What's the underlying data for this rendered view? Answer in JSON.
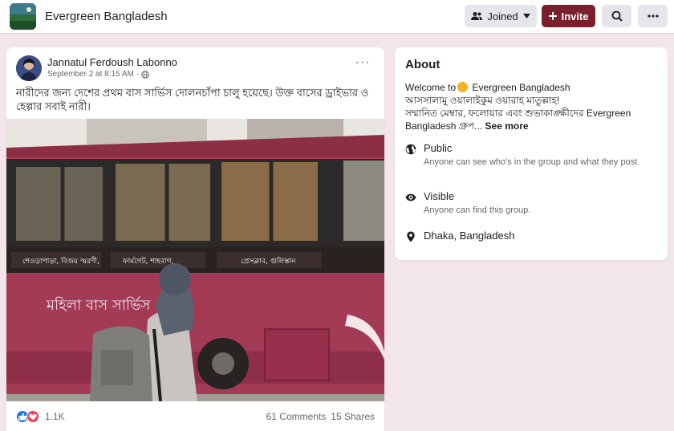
{
  "header": {
    "group_name": "Evergreen Bangladesh",
    "joined_label": "Joined",
    "invite_label": "Invite"
  },
  "post": {
    "author": "Jannatul Ferdoush Labonno",
    "date": "September 2 at 8:15 AM",
    "privacy_icon": "globe-icon",
    "text": "নারীদের জন্য দেশের প্রথম বাস সার্ভিস দোলনচাঁপা চালু হয়েছে। উক্ত বাসের ড্রাইভার ও হেল্পার সবাই নারী।",
    "photo": {
      "route_1": "শেওড়াপাড়া, বিজয় স্মরণী,",
      "route_2": "ফার্মগেট, শাহবাগ,",
      "route_3": "প্রেসক্লাব, গুলিস্তান",
      "bus_label": "মহিলা বাস সার্ভিস"
    },
    "reaction_count": "1.1K",
    "comments": "61 Comments",
    "shares": "15 Shares"
  },
  "about": {
    "title": "About",
    "welcome": "Welcome to",
    "welcome_group": "Evergreen Bangladesh",
    "greeting": "আসসালামু ওয়ালাইকুম ওয়ারাহ মাতুল্লাহ!",
    "desc_line": "সম্মানিত মেম্বার, ফলোয়ার এবং শুভাকাঙ্ক্ষীদের Evergreen Bangladesh গ্রুপ...",
    "see_more": "See more",
    "public_title": "Public",
    "public_desc": "Anyone can see who's in the group and what they post.",
    "visible_title": "Visible",
    "visible_desc": "Anyone can find this group.",
    "location": "Dhaka, Bangladesh"
  },
  "colors": {
    "accent": "#7a1f2c",
    "page_bg": "#f2e6ea",
    "bus_body": "#a33b57"
  }
}
